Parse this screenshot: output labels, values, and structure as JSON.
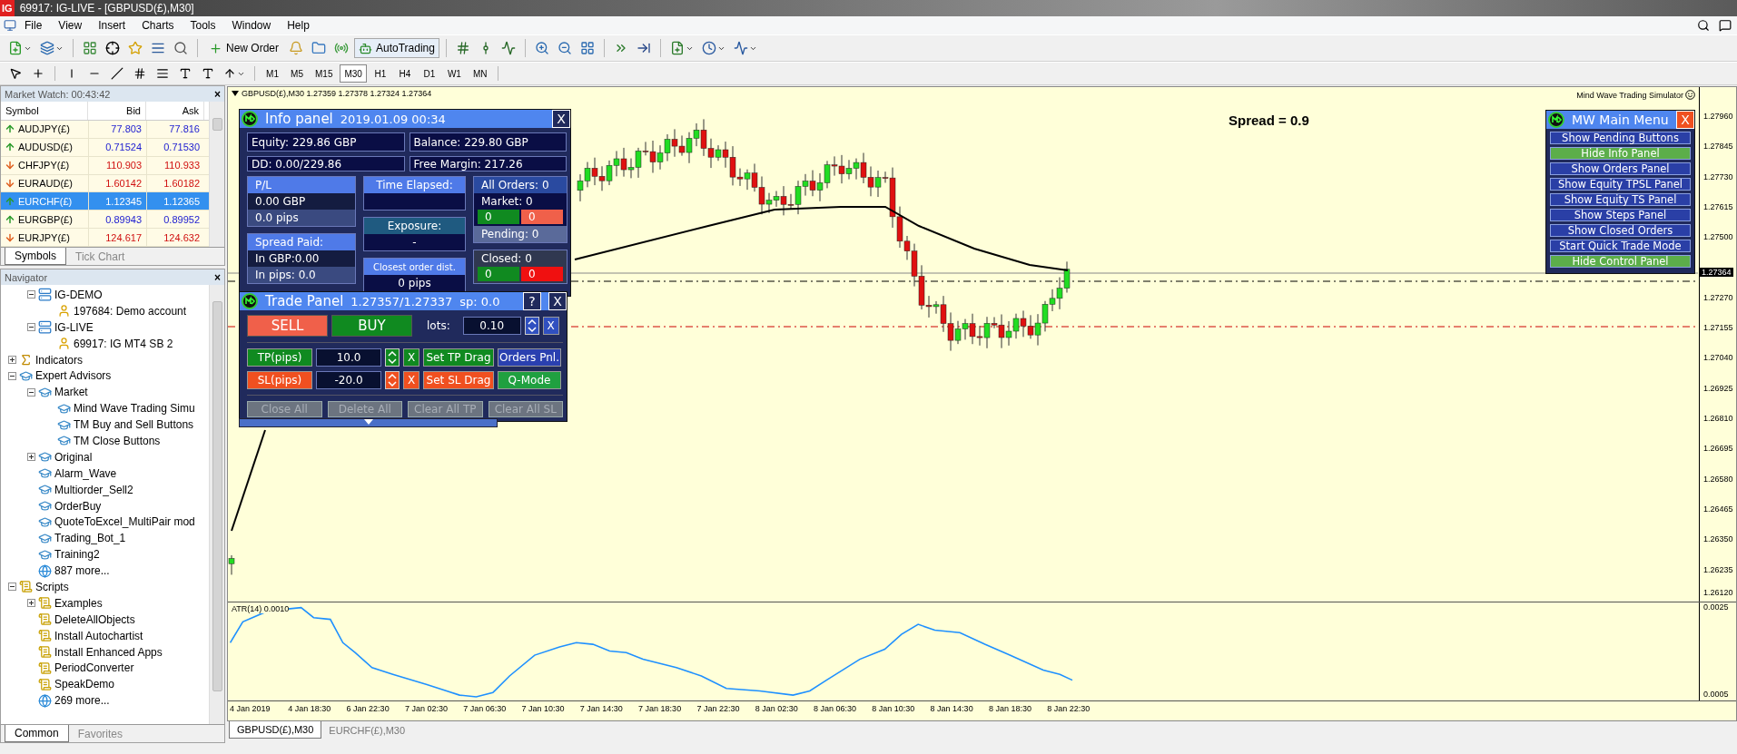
{
  "window": {
    "logo": "IG",
    "title": "69917: IG-LIVE - [GBPUSD(£),M30]"
  },
  "menu": [
    "File",
    "View",
    "Insert",
    "Charts",
    "Tools",
    "Window",
    "Help"
  ],
  "toolbar": {
    "new_order": "New Order",
    "autotrading": "AutoTrading"
  },
  "timeframes": [
    {
      "label": "M1",
      "selected": false
    },
    {
      "label": "M5",
      "selected": false
    },
    {
      "label": "M15",
      "selected": false
    },
    {
      "label": "M30",
      "selected": true
    },
    {
      "label": "H1",
      "selected": false
    },
    {
      "label": "H4",
      "selected": false
    },
    {
      "label": "D1",
      "selected": false
    },
    {
      "label": "W1",
      "selected": false
    },
    {
      "label": "MN",
      "selected": false
    }
  ],
  "market_watch": {
    "title": "Market Watch: 00:43:42",
    "close": "×",
    "columns": [
      "Symbol",
      "Bid",
      "Ask"
    ],
    "rows": [
      {
        "symbol": "AUDJPY(£)",
        "bid": "77.803",
        "ask": "77.816",
        "up": true,
        "selected": false
      },
      {
        "symbol": "AUDUSD(£)",
        "bid": "0.71524",
        "ask": "0.71530",
        "up": true,
        "selected": false
      },
      {
        "symbol": "CHFJPY(£)",
        "bid": "110.903",
        "ask": "110.933",
        "up": false,
        "selected": false
      },
      {
        "symbol": "EURAUD(£)",
        "bid": "1.60142",
        "ask": "1.60182",
        "up": false,
        "selected": false
      },
      {
        "symbol": "EURCHF(£)",
        "bid": "1.12345",
        "ask": "1.12365",
        "up": true,
        "selected": true
      },
      {
        "symbol": "EURGBP(£)",
        "bid": "0.89943",
        "ask": "0.89952",
        "up": true,
        "selected": false
      },
      {
        "symbol": "EURJPY(£)",
        "bid": "124.617",
        "ask": "124.632",
        "up": false,
        "selected": false
      }
    ],
    "tabs": [
      {
        "label": "Symbols",
        "selected": true
      },
      {
        "label": "Tick Chart",
        "selected": false
      }
    ]
  },
  "navigator": {
    "title": "Navigator",
    "close": "×",
    "scrolled_branch": [
      {
        "label": "IG-DEMO",
        "kind": "server",
        "expanded": true,
        "children": [
          {
            "label": "197684: Demo account",
            "kind": "account"
          }
        ]
      },
      {
        "label": "IG-LIVE",
        "kind": "server",
        "expanded": true,
        "children": [
          {
            "label": "69917: IG MT4 SB 2",
            "kind": "account"
          }
        ]
      }
    ],
    "items": [
      {
        "label": "Indicators",
        "kind": "indicators",
        "expanded": false
      },
      {
        "label": "Expert Advisors",
        "kind": "expert",
        "expanded": true,
        "children": [
          {
            "label": "Market",
            "kind": "expert",
            "expanded": true,
            "children": [
              {
                "label": "Mind Wave Trading Simu",
                "kind": "expert"
              },
              {
                "label": "TM Buy and Sell Buttons",
                "kind": "expert"
              },
              {
                "label": "TM Close Buttons",
                "kind": "expert"
              }
            ]
          },
          {
            "label": "Original",
            "kind": "expert",
            "expanded": false
          },
          {
            "label": "Alarm_Wave",
            "kind": "expert"
          },
          {
            "label": "Multiorder_Sell2",
            "kind": "expert"
          },
          {
            "label": "OrderBuy",
            "kind": "expert"
          },
          {
            "label": "QuoteToExcel_MultiPair mod",
            "kind": "expert"
          },
          {
            "label": "Trading_Bot_1",
            "kind": "expert"
          },
          {
            "label": "Training2",
            "kind": "expert"
          },
          {
            "label": "887 more...",
            "kind": "more"
          }
        ]
      },
      {
        "label": "Scripts",
        "kind": "script",
        "expanded": true,
        "children": [
          {
            "label": "Examples",
            "kind": "script",
            "expanded": false
          },
          {
            "label": "DeleteAllObjects",
            "kind": "script"
          },
          {
            "label": "Install Autochartist",
            "kind": "script"
          },
          {
            "label": "Install Enhanced Apps",
            "kind": "script"
          },
          {
            "label": "PeriodConverter",
            "kind": "script"
          },
          {
            "label": "SpeakDemo",
            "kind": "script"
          },
          {
            "label": "269 more...",
            "kind": "more"
          }
        ]
      }
    ],
    "tabs": [
      {
        "label": "Common",
        "selected": true
      },
      {
        "label": "Favorites",
        "selected": false
      }
    ]
  },
  "chart": {
    "header": "GBPUSD(£),M30  1.27359 1.27378 1.27324 1.27364",
    "spread_text": "Spread = 0.9",
    "simulator_label": "Mind Wave Trading Simulator",
    "price_ticks_upper": [
      "1.27960",
      "1.27845",
      "1.27730",
      "1.27615",
      "1.27500"
    ],
    "price_ticks_lower": [
      "1.27270",
      "1.27155",
      "1.27040",
      "1.26925",
      "1.26810",
      "1.26695",
      "1.26580",
      "1.26465",
      "1.26350",
      "1.26235",
      "1.26120"
    ],
    "current_price": "1.27364",
    "atr_label": "ATR(14) 0.0010",
    "atr_ticks": [
      "0.0025",
      "0.0005"
    ],
    "time_ticks": [
      "4 Jan 2019",
      "4 Jan 18:30",
      "6 Jan 22:30",
      "7 Jan 02:30",
      "7 Jan 06:30",
      "7 Jan 10:30",
      "7 Jan 14:30",
      "7 Jan 18:30",
      "7 Jan 22:30",
      "8 Jan 02:30",
      "8 Jan 06:30",
      "8 Jan 10:30",
      "8 Jan 14:30",
      "8 Jan 18:30",
      "8 Jan 22:30"
    ],
    "tabs": [
      {
        "label": "GBPUSD(£),M30",
        "selected": true
      },
      {
        "label": "EURCHF(£),M30",
        "selected": false
      }
    ]
  },
  "info_panel": {
    "title": "Info panel",
    "datetime": "2019.01.09 00:34",
    "close": "X",
    "equity": "Equity: 229.86 GBP",
    "balance": "Balance: 229.80 GBP",
    "dd": "DD: 0.00/229.86",
    "free_margin": "Free Margin: 217.26",
    "pl": {
      "header": "P/L",
      "gbp": "0.00 GBP",
      "pips": "0.0 pips"
    },
    "spread": {
      "header": "Spread Paid:",
      "gbp": "In GBP:0.00",
      "pips": "In pips: 0.0"
    },
    "time_elapsed": {
      "header": "Time Elapsed:"
    },
    "exposure": {
      "header": "Exposure:",
      "value": "-"
    },
    "closest": {
      "header": "Closest order dist.",
      "value": "0 pips"
    },
    "orders": {
      "all": "All Orders: 0",
      "market": "Market: 0",
      "market_buy": "0",
      "market_sell": "0",
      "pending": "Pending: 0",
      "closed": "Closed: 0",
      "closed_buy": "0",
      "closed_sell": "0"
    }
  },
  "trade_panel": {
    "title": "Trade Panel",
    "prices": "1.27357/1.27337",
    "spread": "sp: 0.0",
    "help": "?",
    "close": "X",
    "sell": "SELL",
    "buy": "BUY",
    "lots_label": "lots:",
    "lots": "0.10",
    "lots_clear": "X",
    "tp": {
      "label": "TP(pips)",
      "value": "10.0",
      "clear": "X"
    },
    "sl": {
      "label": "SL(pips)",
      "value": "-20.0",
      "clear": "X"
    },
    "set_tp": "Set TP Drag",
    "set_sl": "Set SL Drag",
    "orders_pnl": "Orders Pnl.",
    "qmode": "Q-Mode",
    "bottom_buttons": [
      {
        "label": "Close All",
        "disabled": true
      },
      {
        "label": "Delete All",
        "disabled": true
      },
      {
        "label": "Clear All TP",
        "disabled": true
      },
      {
        "label": "Clear All SL",
        "disabled": true
      }
    ]
  },
  "mw_menu": {
    "title": "MW Main Menu",
    "close": "X",
    "items": [
      {
        "label": "Show Pending Buttons",
        "on": false
      },
      {
        "label": "Hide Info Panel",
        "on": true
      },
      {
        "label": "Show Orders Panel",
        "on": false
      },
      {
        "label": "Show Equity TPSL Panel",
        "on": false
      },
      {
        "label": "Show Equity TS Panel",
        "on": false
      },
      {
        "label": "Show Steps Panel",
        "on": false
      },
      {
        "label": "Show Closed Orders",
        "on": false
      },
      {
        "label": "Start Quick Trade Mode",
        "on": false
      },
      {
        "label": "Hide Control Panel",
        "on": true
      }
    ]
  }
}
